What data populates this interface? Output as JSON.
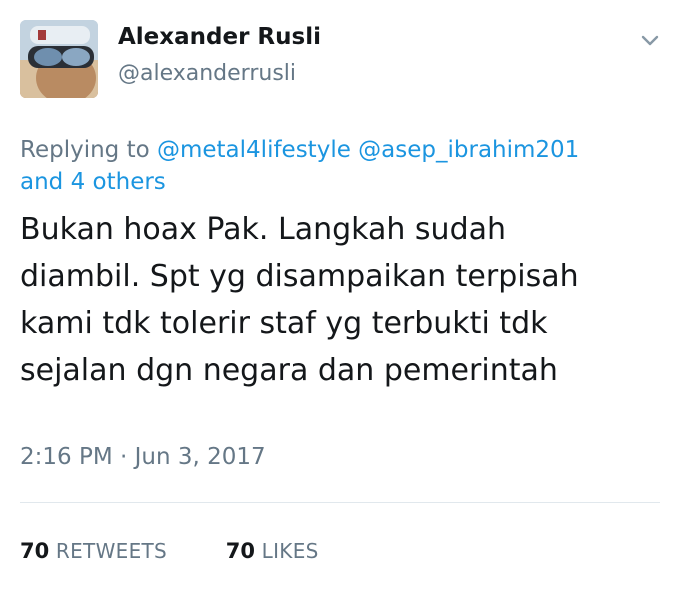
{
  "user": {
    "name": "Alexander Rusli",
    "handle": "@alexanderrusli"
  },
  "reply": {
    "prefix": "Replying to",
    "mentions": [
      "@metal4lifestyle",
      "@asep_ibrahim201"
    ],
    "others": "and 4 others"
  },
  "tweet": {
    "lines": [
      "Bukan hoax Pak. Langkah sudah",
      "diambil. Spt yg disampaikan terpisah",
      "kami tdk tolerir staf yg terbukti tdk",
      "sejalan dgn negara dan pemerintah"
    ],
    "timestamp": "2:16 PM · Jun 3, 2017"
  },
  "stats": {
    "retweets_count": "70",
    "retweets_label": "RETWEETS",
    "likes_count": "70",
    "likes_label": "LIKES"
  },
  "colors": {
    "link": "#1b95e0",
    "secondary": "#657786",
    "primary": "#14171a",
    "divider": "#e1e8ed"
  },
  "icons": {
    "menu": "chevron-down-icon"
  }
}
